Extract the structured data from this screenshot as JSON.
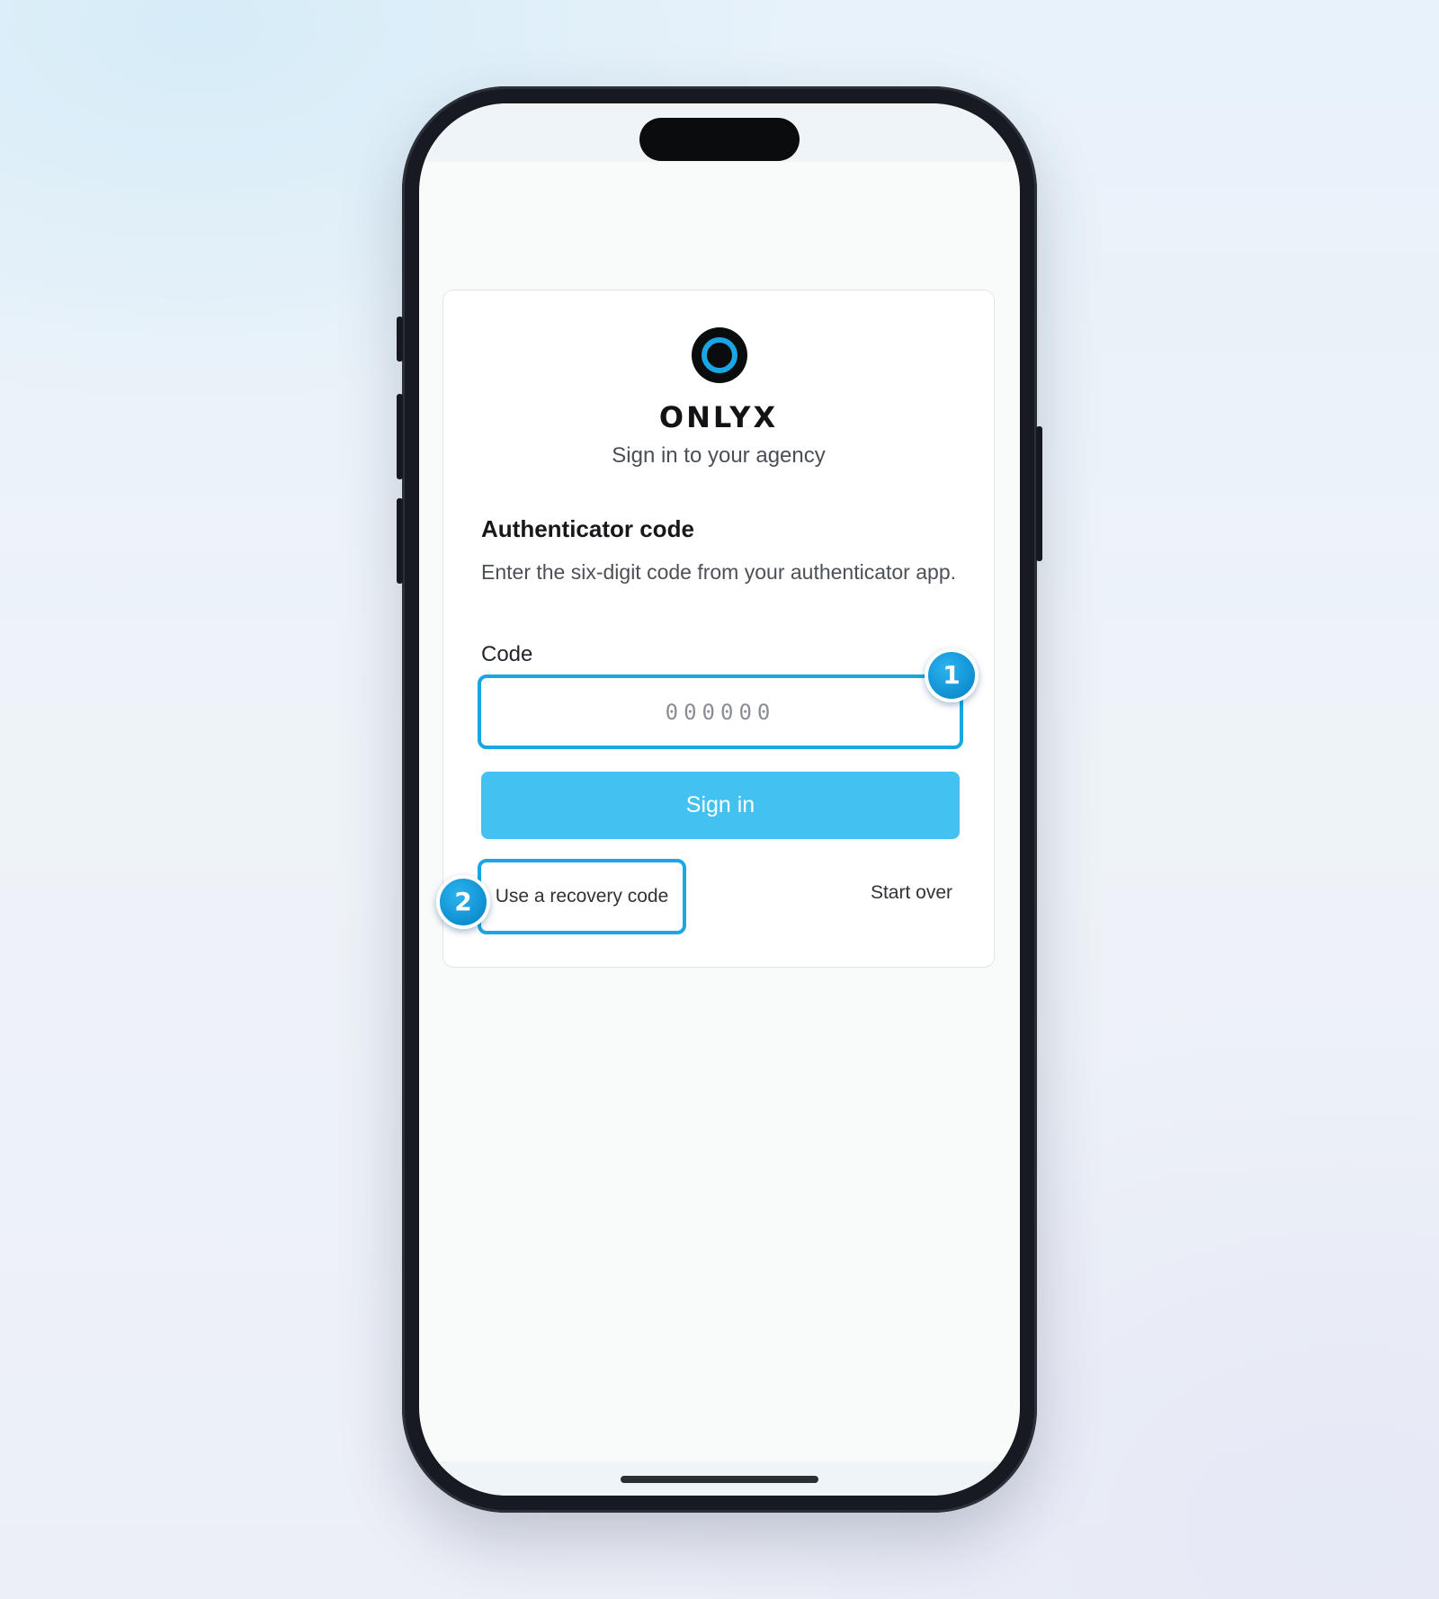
{
  "app": {
    "brand_name": "ONLYX",
    "subtitle": "Sign in to your agency"
  },
  "auth": {
    "heading": "Authenticator code",
    "description": "Enter the six-digit code from your authenticator app.",
    "code_label": "Code",
    "code_placeholder": "000000",
    "code_value": "",
    "signin_label": "Sign in",
    "recovery_label": "Use a recovery code",
    "startover_label": "Start over"
  },
  "annotations": {
    "badge_1": "1",
    "badge_2": "2"
  },
  "colors": {
    "accent": "#1aa6e2",
    "button": "#43c2f1",
    "logo_ring": "#1aa6e2",
    "logo_dark": "#0b0c0e"
  },
  "icons": {
    "logo": "onlyx-ring-logo-icon"
  }
}
